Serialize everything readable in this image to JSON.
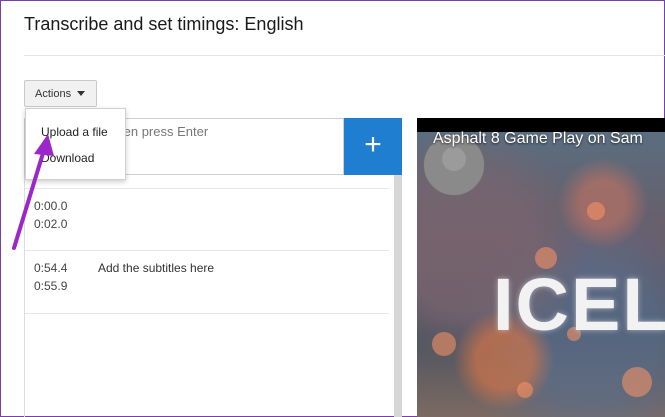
{
  "page": {
    "title": "Transcribe and set timings: English"
  },
  "toolbar": {
    "actions_label": "Actions"
  },
  "actions_menu": {
    "items": [
      "Upload a file",
      "Download"
    ]
  },
  "subtitle_input": {
    "placeholder": "re, then press Enter",
    "add_label": "+"
  },
  "subtitles": [
    {
      "start": "0:00.0",
      "end": "0:02.0",
      "text": ""
    },
    {
      "start": "0:54.4",
      "end": "0:55.9",
      "text": "Add the subtitles here"
    }
  ],
  "video": {
    "title": "Asphalt 8 Game Play on Sam",
    "overlay_text": "ICEL"
  },
  "colors": {
    "accent": "#1f7ed0",
    "annotation_arrow": "#9b27c8",
    "frame_border": "#7a3ea8"
  }
}
